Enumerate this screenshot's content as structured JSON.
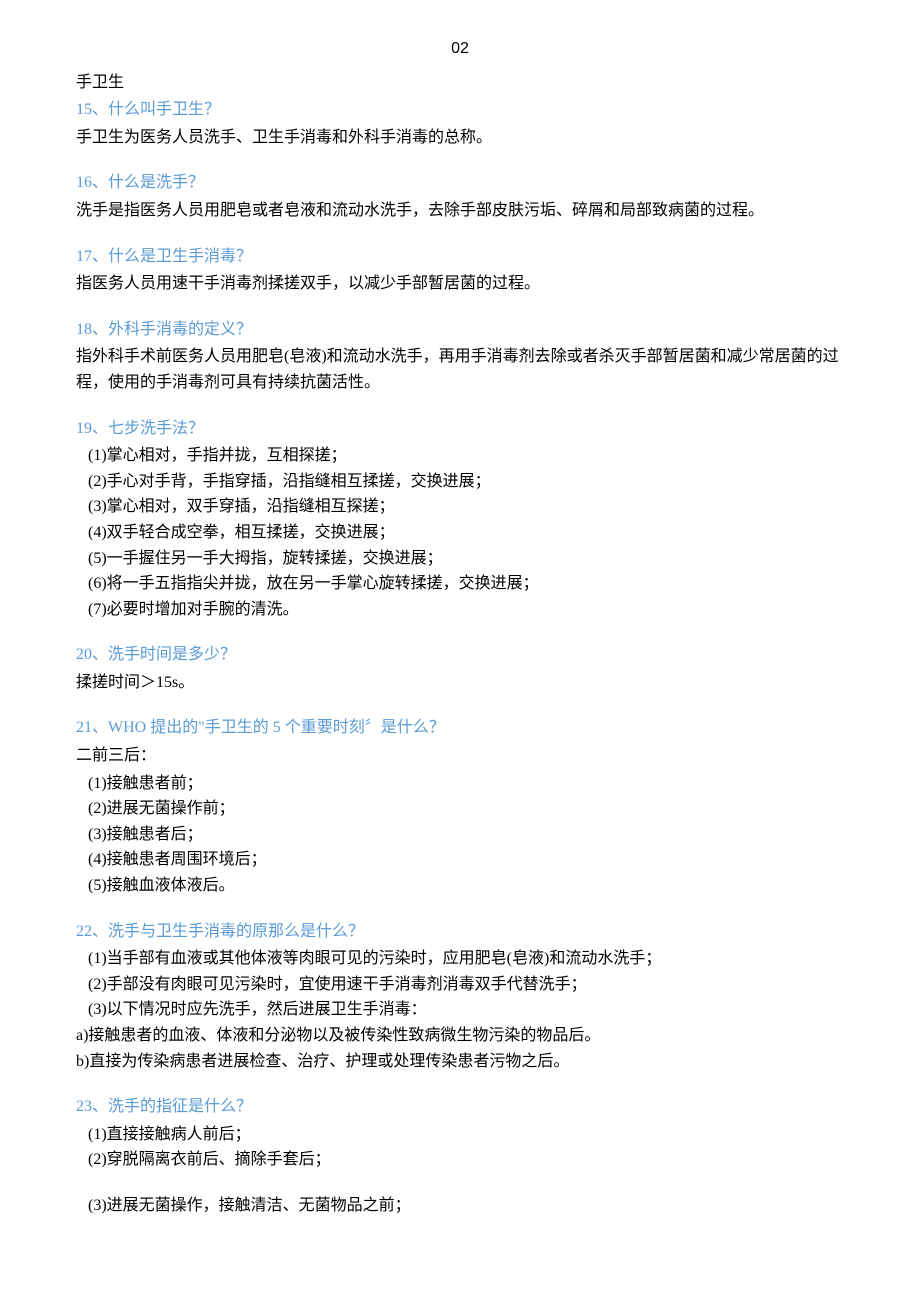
{
  "page_number": "02",
  "section_title": "手卫生",
  "questions": [
    {
      "q": "15、什么叫手卫生？",
      "a": [
        "手卫生为医务人员洗手、卫生手消毒和外科手消毒的总称。"
      ]
    },
    {
      "q": "16、什么是洗手？",
      "a": [
        "洗手是指医务人员用肥皂或者皂液和流动水洗手，去除手部皮肤污垢、碎屑和局部致病菌的过程。"
      ]
    },
    {
      "q": "17、什么是卫生手消毒？",
      "a": [
        "指医务人员用速干手消毒剂揉搓双手，以减少手部暂居菌的过程。"
      ]
    },
    {
      "q": "18、外科手消毒的定义？",
      "a": [
        "指外科手术前医务人员用肥皂(皂液)和流动水洗手，再用手消毒剂去除或者杀灭手部暂居菌和减少常居菌的过程，使用的手消毒剂可具有持续抗菌活性。"
      ]
    },
    {
      "q": "19、七步洗手法？",
      "list": [
        "(1)掌心相对，手指并拢，互相探搓；",
        "(2)手心对手背，手指穿插，沿指缝相互揉搓，交换进展；",
        "(3)掌心相对，双手穿插，沿指缝相互探搓；",
        "(4)双手轻合成空拳，相互揉搓，交换进展；",
        "(5)一手握住另一手大拇指，旋转揉搓，交换进展；",
        "(6)将一手五指指尖并拢，放在另一手掌心旋转揉搓，交换进展；",
        "(7)必要时增加对手腕的清洗。"
      ]
    },
    {
      "q": "20、洗手时间是多少？",
      "a": [
        "揉搓时间＞15s。"
      ]
    },
    {
      "q": "21、WHO 提出的\"手卫生的 5 个重要时刻〞是什么？",
      "a": [
        "二前三后："
      ],
      "list": [
        "(1)接触患者前；",
        "(2)进展无菌操作前；",
        "(3)接触患者后；",
        "(4)接触患者周围环境后；",
        "(5)接触血液体液后。"
      ]
    },
    {
      "q": "22、洗手与卫生手消毒的原那么是什么？",
      "list": [
        "(1)当手部有血液或其他体液等肉眼可见的污染时，应用肥皂(皂液)和流动水洗手；",
        "(2)手部没有肉眼可见污染时，宜使用速干手消毒剂消毒双手代替洗手；",
        "(3)以下情况时应先洗手，然后进展卫生手消毒："
      ],
      "sub": [
        "a)接触患者的血液、体液和分泌物以及被传染性致病微生物污染的物品后。",
        "b)直接为传染病患者进展检查、治疗、护理或处理传染患者污物之后。"
      ]
    },
    {
      "q": "23、洗手的指征是什么？",
      "list": [
        "(1)直接接触病人前后；",
        "(2)穿脱隔离衣前后、摘除手套后；"
      ],
      "gap_list": [
        "(3)进展无菌操作，接触清洁、无菌物品之前；"
      ]
    }
  ]
}
